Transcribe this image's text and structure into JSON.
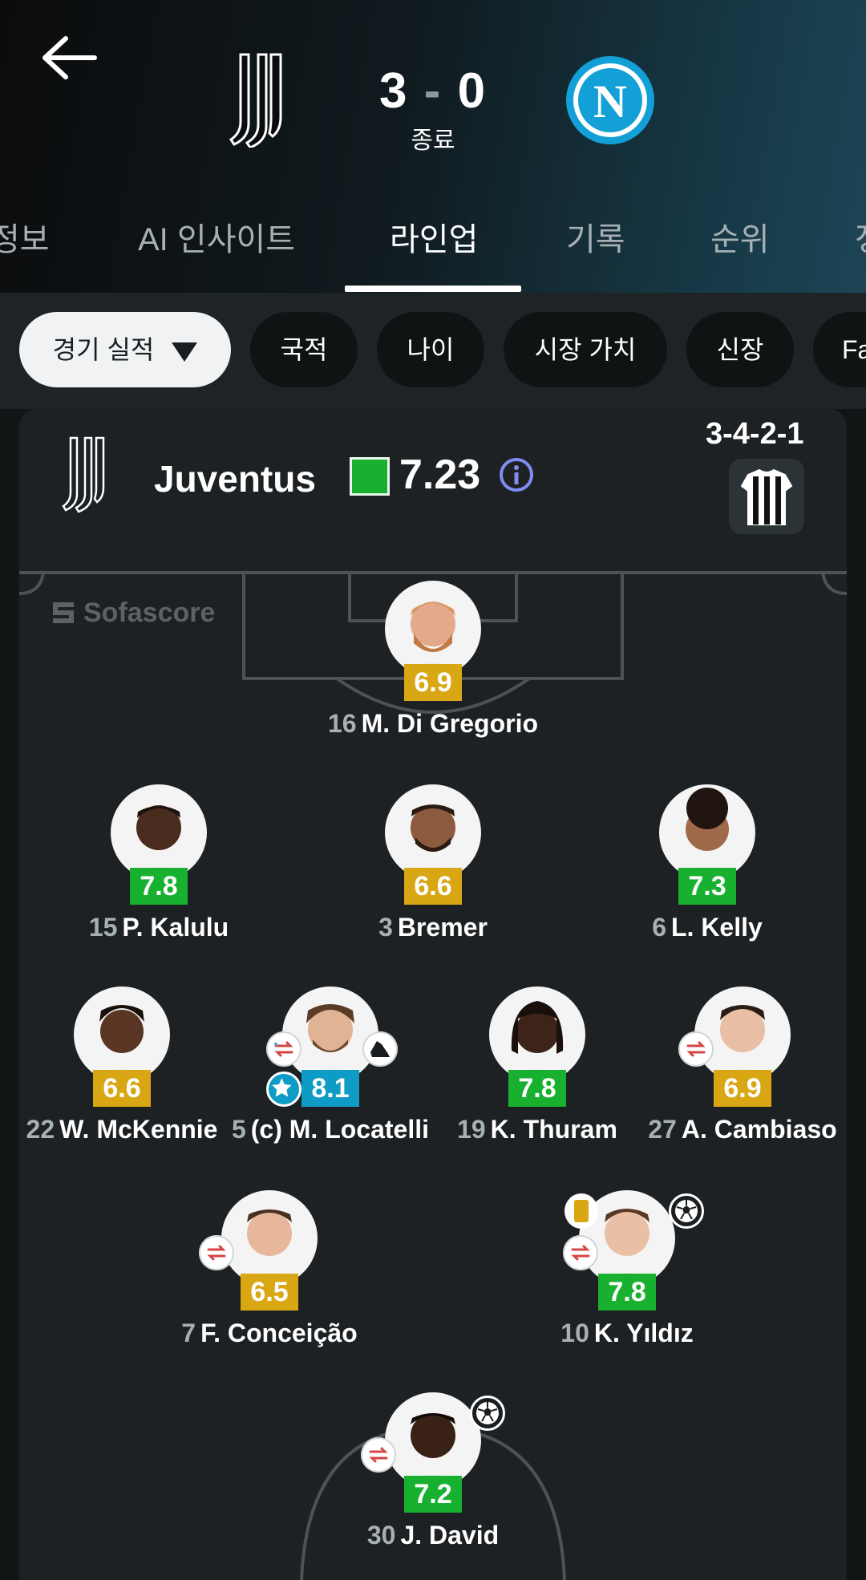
{
  "match": {
    "score_home": "3",
    "score_sep": "-",
    "score_away": "0",
    "status": "종료"
  },
  "tabs": [
    {
      "label": "정보"
    },
    {
      "label": "AI 인사이트"
    },
    {
      "label": "라인업"
    },
    {
      "label": "기록"
    },
    {
      "label": "순위"
    },
    {
      "label": "정"
    }
  ],
  "filters": [
    {
      "label": "경기 실적"
    },
    {
      "label": "국적"
    },
    {
      "label": "나이"
    },
    {
      "label": "시장 가치"
    },
    {
      "label": "신장"
    },
    {
      "label": "Fa"
    }
  ],
  "team": {
    "name": "Juventus",
    "rating": "7.23",
    "formation": "3-4-2-1",
    "watermark": "Sofascore"
  },
  "players": [
    {
      "number": "16",
      "name": "M. Di Gregorio",
      "rating": "6.9"
    },
    {
      "number": "15",
      "name": "P. Kalulu",
      "rating": "7.8"
    },
    {
      "number": "3",
      "name": "Bremer",
      "rating": "6.6"
    },
    {
      "number": "6",
      "name": "L. Kelly",
      "rating": "7.3"
    },
    {
      "number": "22",
      "name": "W. McKennie",
      "rating": "6.6"
    },
    {
      "number": "5",
      "name": "(c) M. Locatelli",
      "rating": "8.1"
    },
    {
      "number": "19",
      "name": "K. Thuram",
      "rating": "7.8"
    },
    {
      "number": "27",
      "name": "A. Cambiaso",
      "rating": "6.9"
    },
    {
      "number": "7",
      "name": "F. Conceição",
      "rating": "6.5"
    },
    {
      "number": "10",
      "name": "K. Yıldız",
      "rating": "7.8"
    },
    {
      "number": "30",
      "name": "J. David",
      "rating": "7.2"
    }
  ],
  "colors": {
    "rating_green": "#18b02f",
    "rating_yellow": "#d8a713",
    "rating_blue": "#0e9cc6",
    "napoli_blue": "#12a0d7"
  }
}
